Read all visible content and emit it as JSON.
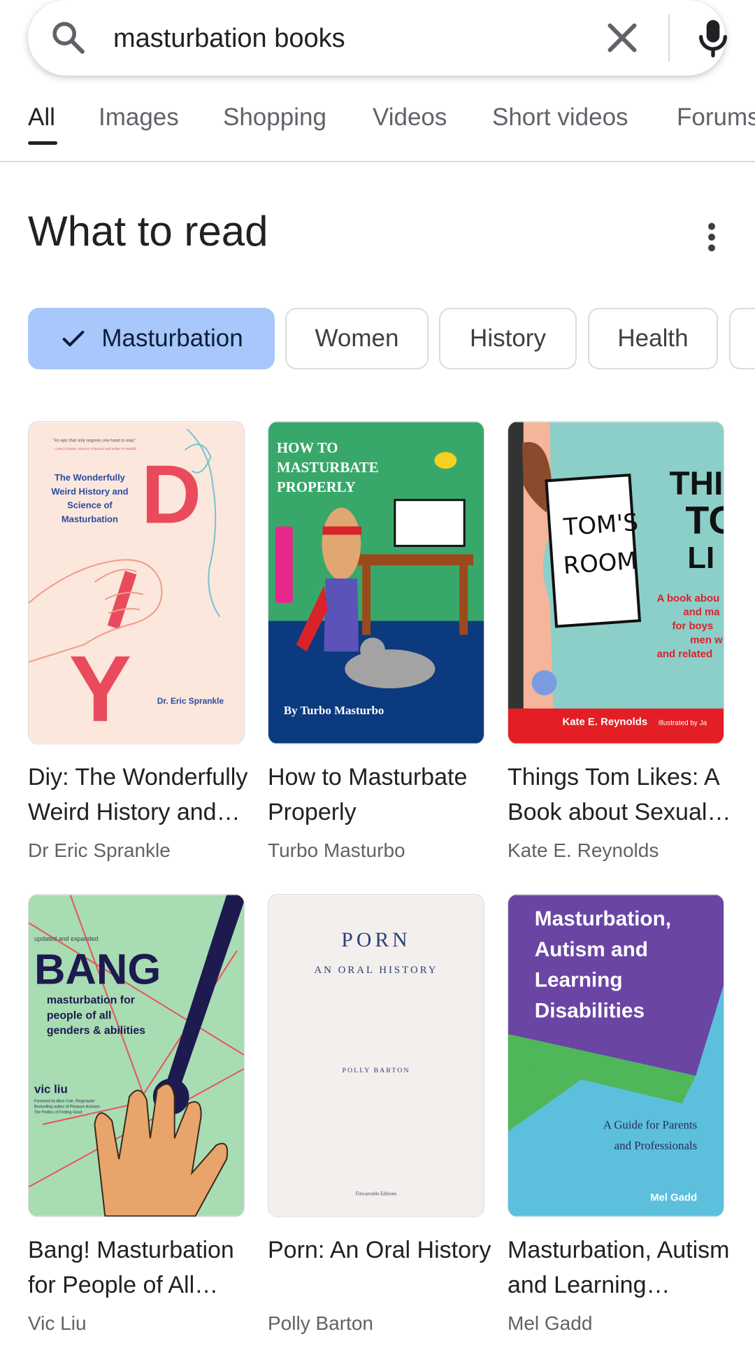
{
  "search": {
    "query": "masturbation books"
  },
  "tabs": [
    {
      "label": "All"
    },
    {
      "label": "Images"
    },
    {
      "label": "Shopping"
    },
    {
      "label": "Videos"
    },
    {
      "label": "Short videos"
    },
    {
      "label": "Forums"
    }
  ],
  "section": {
    "title": "What to read"
  },
  "chips": [
    {
      "label": "Masturbation",
      "selected": true
    },
    {
      "label": "Women"
    },
    {
      "label": "History"
    },
    {
      "label": "Health"
    }
  ],
  "books": [
    {
      "title": "Diy: The Wonderfully Weird History and Science of Masturbation",
      "author": "Dr Eric Sprankle",
      "cover": {
        "quote": "\"An epic that only requires one hand to read.\"",
        "quote_attr": "- Larry Chester, director of Bored and writer for Reddit",
        "subtitle_lines": [
          "The Wonderfully",
          "Weird History and",
          "Science of",
          "Masturbation"
        ],
        "letters": [
          "D",
          "I",
          "Y"
        ],
        "author": "Dr. Eric Sprankle"
      }
    },
    {
      "title": "How to Masturbate Properly",
      "author": "Turbo Masturbo",
      "cover": {
        "title_lines": [
          "HOW TO",
          "MASTURBATE",
          "PROPERLY"
        ],
        "author": "By Turbo Masturbo"
      }
    },
    {
      "title": "Things Tom Likes: A Book about Sexuality and Masturbation for Boys and Young Men",
      "author": "Kate E. Reynolds",
      "cover": {
        "sign_lines": [
          "TOM'S",
          "ROOM"
        ],
        "title_lines": [
          "THII",
          "TO",
          "LI"
        ],
        "blurb_lines": [
          "A book abou",
          "and ma",
          "for boys",
          "men w",
          "and related"
        ],
        "footer": "Kate E. Reynolds",
        "footer_small": "Illustrated by Ja"
      }
    },
    {
      "title": "Bang! Masturbation for People of All Genders and Abilities",
      "author": "Vic Liu",
      "cover": {
        "edition": "updated and expanded",
        "title": "BANG",
        "subtitle_lines": [
          "masturbation for",
          "people of all",
          "genders & abilities"
        ],
        "author": "vic liu",
        "blurb_lines": [
          "Foreword by Alice Cole, Ringmaster",
          "Bestselling author of Pleasure Activism",
          "The Politics of Feeling Good"
        ]
      }
    },
    {
      "title": "Porn: An Oral History",
      "author": "Polly Barton",
      "cover": {
        "title": "PORN",
        "subtitle": "AN ORAL HISTORY",
        "author": "POLLY BARTON",
        "publisher": "Fitzcarraldo Editions"
      }
    },
    {
      "title": "Masturbation, Autism and Learning Disabilities",
      "author": "Mel Gadd",
      "cover": {
        "title_lines": [
          "Masturbation,",
          "Autism and",
          "Learning",
          "Disabilities"
        ],
        "subtitle_lines": [
          "A Guide for Parents",
          "and Professionals"
        ],
        "author": "Mel Gadd"
      }
    }
  ]
}
